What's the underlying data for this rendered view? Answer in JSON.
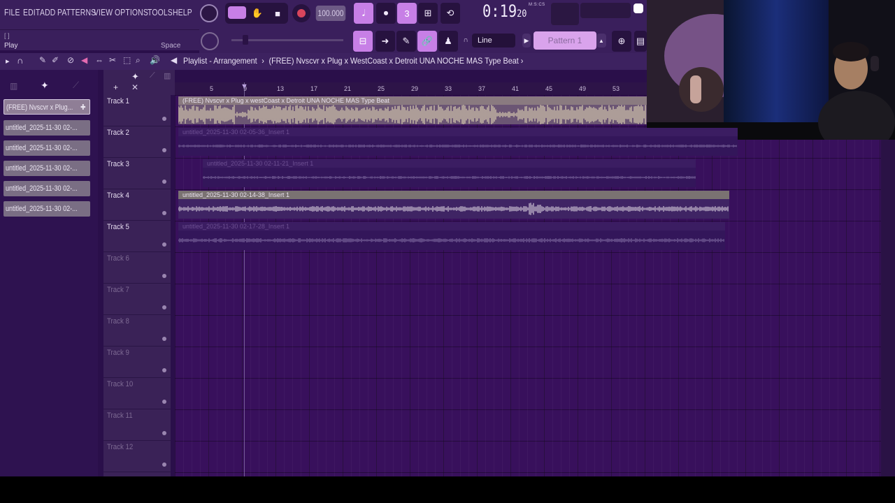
{
  "menu": [
    "FILE",
    "EDIT",
    "ADD",
    "PATTERNS",
    "VIEW",
    "OPTIONS",
    "TOOLS",
    "HELP"
  ],
  "hint": {
    "top": "[ ]",
    "label": "Play",
    "shortcut": "Space"
  },
  "transport": {
    "tempo": "100.000",
    "time_main": "0:19",
    "time_small": "20",
    "time_unit": "M:S:CS"
  },
  "snap": "Line",
  "pattern": "Pattern 1",
  "playlist": {
    "title": "Playlist - Arrangement",
    "separator": "›",
    "song": "(FREE) Nvscvr x Plug x WestCoast x Detroit UNA NOCHE MAS  Type Beat",
    "trailing": "›"
  },
  "ruler": [
    "5",
    "9",
    "13",
    "17",
    "21",
    "25",
    "29",
    "33",
    "37",
    "41",
    "45",
    "49",
    "53"
  ],
  "browser_clips": [
    "(FREE) Nvscvr x Plug...",
    "untitled_2025-11-30 02-...",
    "untitled_2025-11-30 02-...",
    "untitled_2025-11-30 02-...",
    "untitled_2025-11-30 02-...",
    "untitled_2025-11-30 02-..."
  ],
  "tracks": [
    "Track 1",
    "Track 2",
    "Track 3",
    "Track 4",
    "Track 5",
    "Track 6",
    "Track 7",
    "Track 8",
    "Track 9",
    "Track 10",
    "Track 11",
    "Track 12"
  ],
  "clips": [
    {
      "label": "(FREE) Nvscvr x Plug x westCoast x Detroit UNA NOCHE MAS  Type Beat"
    },
    {
      "label": "untitled_2025-11-30 02-05-36_Insert 1"
    },
    {
      "label": "untitled_2025-11-30 02-11-21_Insert 1"
    },
    {
      "label": "untitled_2025-11-30 02-14-38_Insert 1"
    },
    {
      "label": "untitled_2025-11-30 02-17-28_Insert 1"
    }
  ],
  "colors": {
    "accent": "#c77fe6",
    "grid": "#38105c",
    "clip_main": "#cbbfa4",
    "clip_dim": "#4a2a70"
  }
}
